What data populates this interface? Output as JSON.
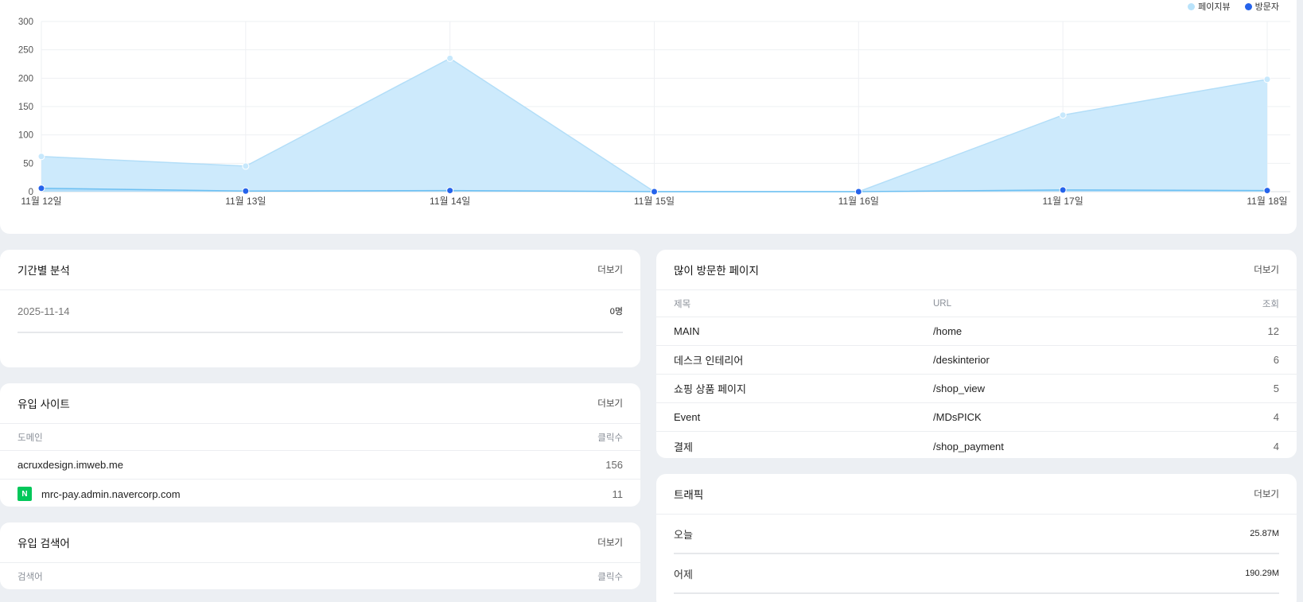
{
  "chart_data": {
    "type": "area",
    "x": [
      "11월 12일",
      "11월 13일",
      "11월 14일",
      "11월 15일",
      "11월 16일",
      "11월 17일",
      "11월 18일"
    ],
    "series": [
      {
        "name": "페이지뷰",
        "values": [
          62,
          45,
          235,
          0,
          0,
          135,
          198
        ],
        "color": "#b9e3fb"
      },
      {
        "name": "방문자",
        "values": [
          6,
          1,
          2,
          0,
          0,
          3,
          2
        ],
        "color": "#2563eb"
      }
    ],
    "yticks": [
      "0",
      "50",
      "100",
      "150",
      "200",
      "250",
      "300"
    ],
    "ylim": [
      0,
      300
    ],
    "grid": true,
    "legend": "top-right"
  },
  "period": {
    "title": "기간별 분석",
    "more": "더보기",
    "date": "2025-11-14",
    "value": "0명"
  },
  "referrers": {
    "title": "유입 사이트",
    "more": "더보기",
    "col_domain": "도메인",
    "col_clicks": "클릭수",
    "rows": [
      {
        "domain": "acruxdesign.imweb.me",
        "clicks": "156"
      },
      {
        "domain": "mrc-pay.admin.navercorp.com",
        "clicks": "11",
        "icon": "naver-icon"
      }
    ]
  },
  "search": {
    "title": "유입 검색어",
    "more": "더보기",
    "col_keyword": "검색어",
    "col_clicks": "클릭수"
  },
  "pages": {
    "title": "많이 방문한 페이지",
    "more": "더보기",
    "col_title": "제목",
    "col_url": "URL",
    "col_views": "조회",
    "rows": [
      {
        "title": "MAIN",
        "url": "/home",
        "views": "12"
      },
      {
        "title": "데스크 인테리어",
        "url": "/deskinterior",
        "views": "6"
      },
      {
        "title": "쇼핑 상품 페이지",
        "url": "/shop_view",
        "views": "5"
      },
      {
        "title": "Event",
        "url": "/MDsPICK",
        "views": "4"
      },
      {
        "title": "결제",
        "url": "/shop_payment",
        "views": "4"
      }
    ]
  },
  "traffic": {
    "title": "트래픽",
    "more": "더보기",
    "rows": [
      {
        "label": "오늘",
        "value": "25.87M"
      },
      {
        "label": "어제",
        "value": "190.29M"
      }
    ]
  }
}
